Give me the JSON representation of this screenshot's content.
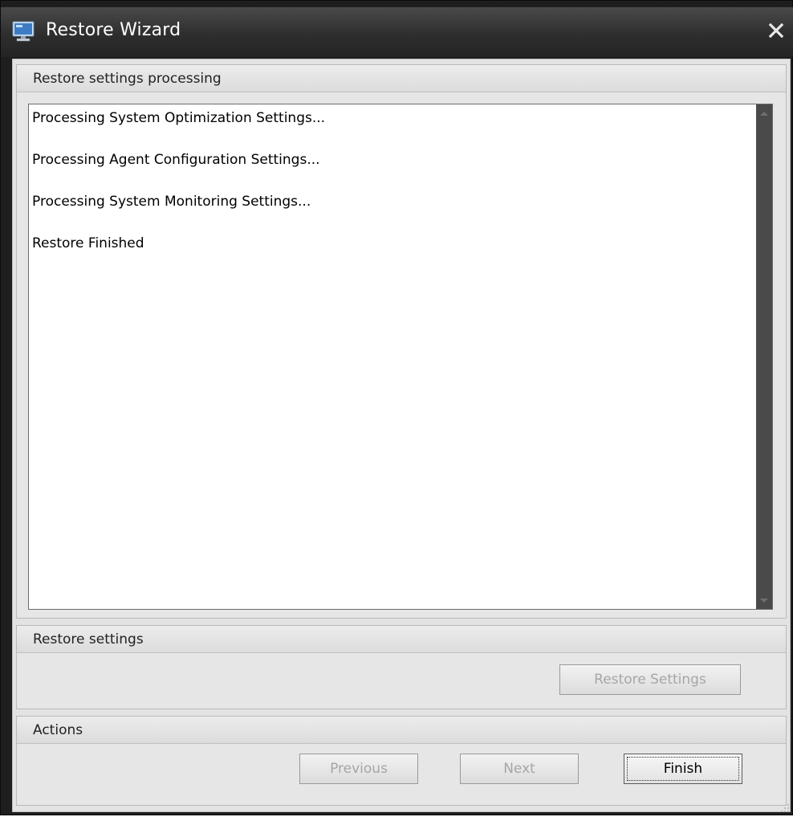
{
  "window": {
    "title": "Restore Wizard",
    "icon": "monitor-icon",
    "close_icon": "close-icon"
  },
  "processing": {
    "header": "Restore settings processing",
    "log": [
      "Processing System Optimization Settings...",
      "Processing Agent Configuration Settings...",
      "Processing System Monitoring Settings...",
      "Restore Finished"
    ]
  },
  "restore_settings": {
    "header": "Restore settings",
    "button_label": "Restore Settings"
  },
  "actions": {
    "header": "Actions",
    "previous_label": "Previous",
    "next_label": "Next",
    "finish_label": "Finish"
  },
  "colors": {
    "titlebar": "#2e2e2e",
    "panel": "#e3e3e3",
    "scrollbar": "#4a4a4a"
  }
}
